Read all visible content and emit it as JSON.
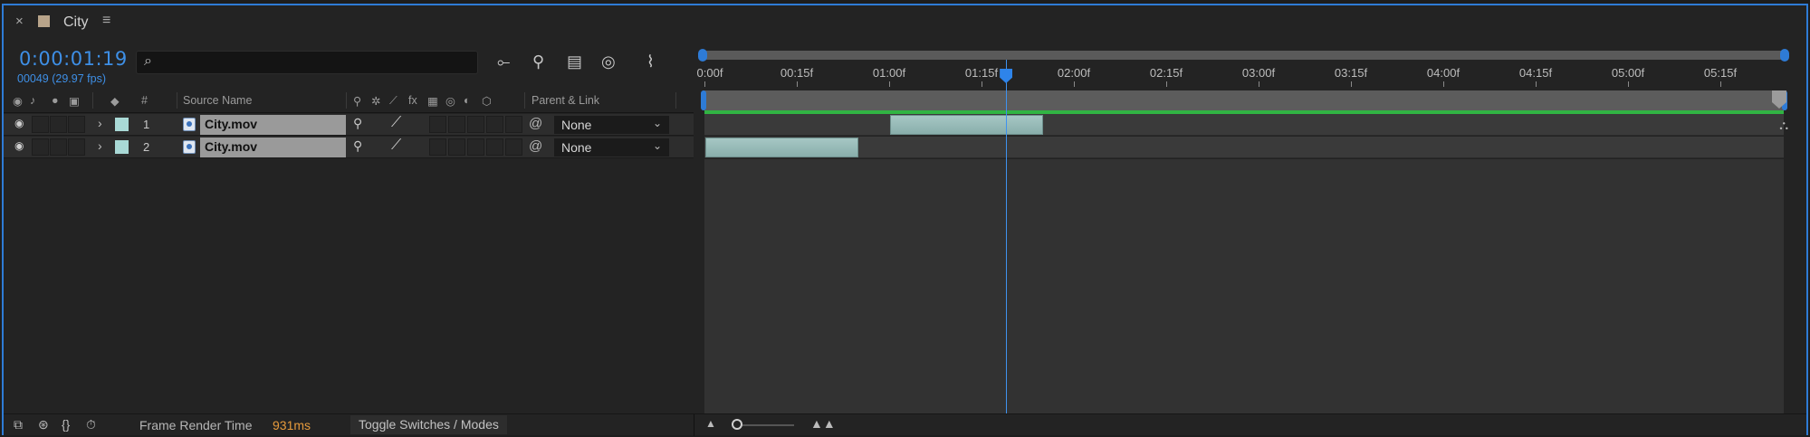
{
  "panel": {
    "close_glyph": "×",
    "title": "City",
    "menu_glyph": "≡",
    "swatch_color": "#b8a48a"
  },
  "time": {
    "timecode": "0:00:01:19",
    "frame_info": "00049 (29.97 fps)"
  },
  "search": {
    "placeholder": "",
    "value": "",
    "icon": "search-icon"
  },
  "toolbar_icons": [
    "composition-flowchart-icon",
    "shy-layers-icon",
    "frame-blending-icon",
    "motion-blur-icon",
    "graph-editor-icon"
  ],
  "columns": {
    "number": "#",
    "source_name": "Source Name",
    "parent_link": "Parent & Link",
    "fx": "fx"
  },
  "layers": [
    {
      "number": "1",
      "name": "City.mov",
      "parent": "None",
      "label_color": "#a9d9d6"
    },
    {
      "number": "2",
      "name": "City.mov",
      "parent": "None",
      "label_color": "#a9d9d6"
    }
  ],
  "ruler": {
    "labels": [
      "0:00f",
      "00:15f",
      "01:00f",
      "01:15f",
      "02:00f",
      "02:15f",
      "03:00f",
      "03:15f",
      "04:00f",
      "04:15f",
      "05:00f",
      "05:15f"
    ]
  },
  "clips": [
    {
      "layer": "1",
      "start_seconds": 1.0,
      "end_seconds": 1.833
    },
    {
      "layer": "2",
      "start_seconds": 0.0,
      "end_seconds": 0.833
    }
  ],
  "playhead": {
    "seconds": 1.633
  },
  "bottom": {
    "frame_render_label": "Frame Render Time",
    "frame_render_value": "931ms",
    "toggle_label": "Toggle Switches / Modes"
  },
  "colors": {
    "accent": "#2e7bd6",
    "timecode": "#3e8fe6",
    "render_time": "#e59a3c",
    "work_area_green": "#31b443",
    "clip": "#a6c7c4"
  }
}
